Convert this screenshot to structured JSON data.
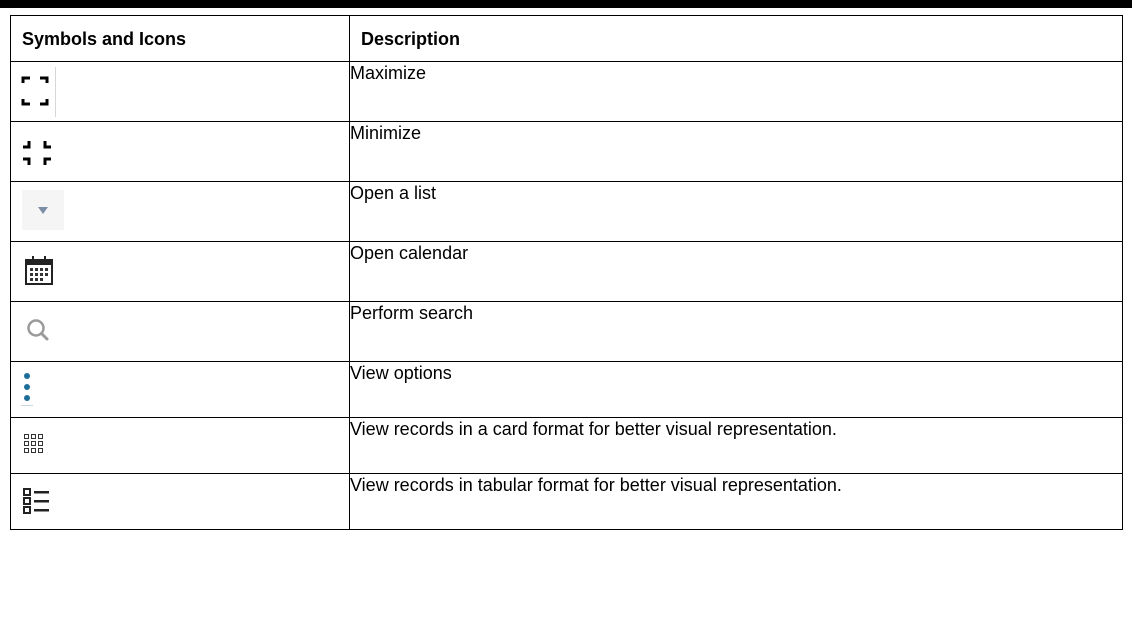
{
  "table": {
    "headers": [
      "Symbols and Icons",
      "Description"
    ],
    "rows": [
      {
        "icon": "maximize-icon",
        "description": "Maximize"
      },
      {
        "icon": "minimize-icon",
        "description": "Minimize"
      },
      {
        "icon": "dropdown-arrow-icon",
        "description": "Open a list"
      },
      {
        "icon": "calendar-icon",
        "description": "Open calendar"
      },
      {
        "icon": "search-icon",
        "description": "Perform search"
      },
      {
        "icon": "vertical-ellipsis-icon",
        "description": "View options"
      },
      {
        "icon": "card-grid-icon",
        "description": "View records in a card format for better visual representation."
      },
      {
        "icon": "list-view-icon",
        "description": "View records in tabular format for better visual representation."
      }
    ]
  },
  "colors": {
    "icon_dark": "#000000",
    "dropdown_arrow": "#7a8fa6",
    "search_gray": "#9a9a9a",
    "ellipsis_blue": "#1f6e9a",
    "grid_dark": "#333333"
  }
}
